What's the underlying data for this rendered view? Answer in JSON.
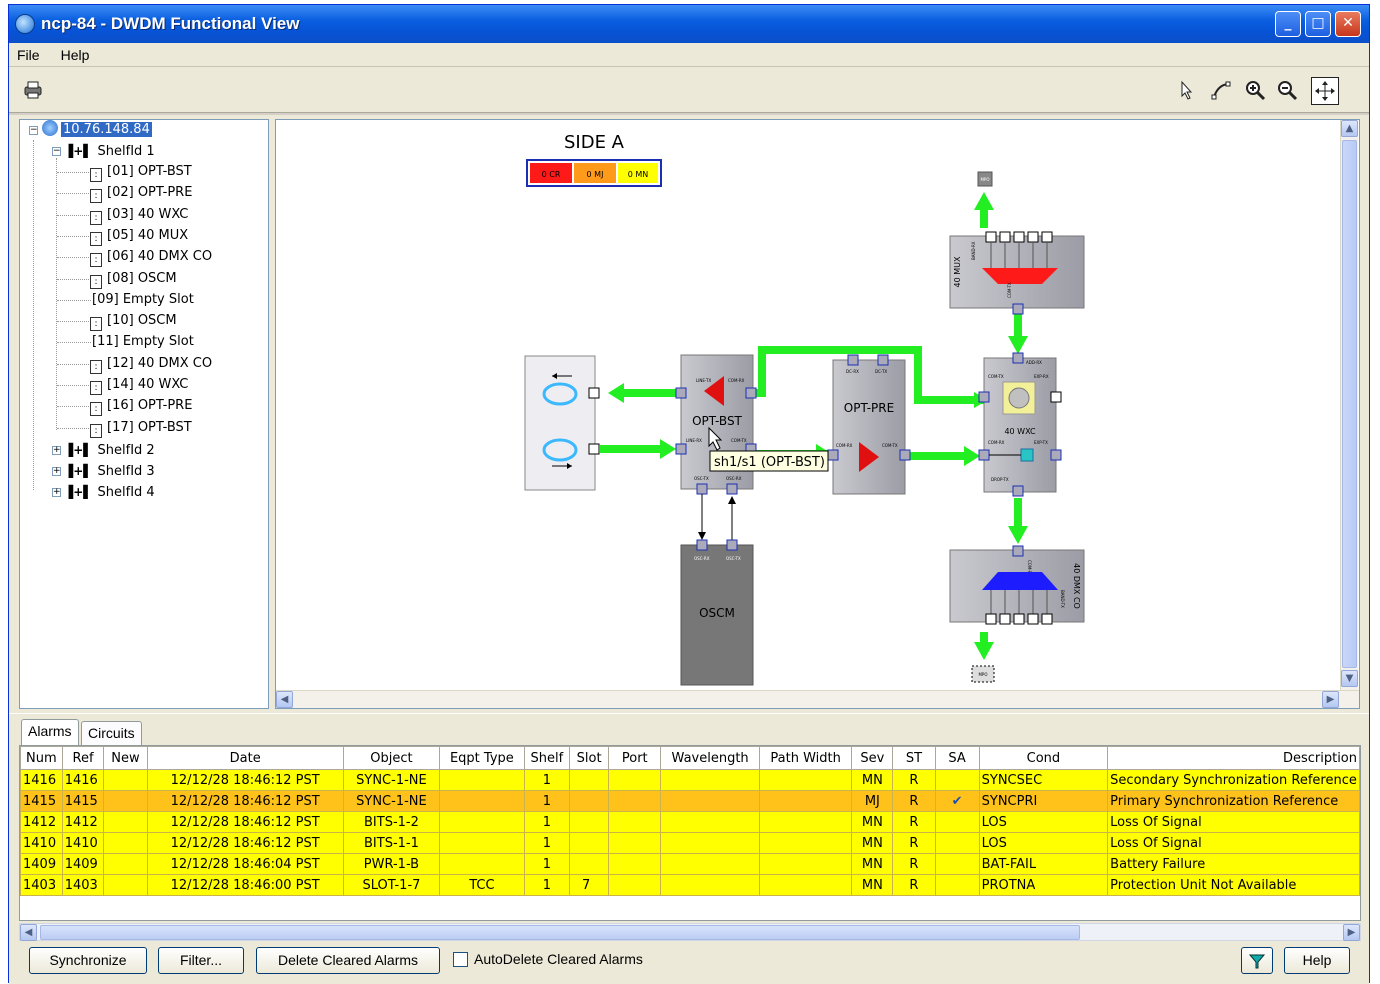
{
  "window": {
    "title": "ncp-84 - DWDM Functional View",
    "minimize": "_",
    "maximize": "□",
    "close": "✕"
  },
  "menu": [
    "File",
    "Help"
  ],
  "toolbar": {
    "print_icon": "printer-icon",
    "zoom_in": "+",
    "zoom_out": "−"
  },
  "tree": {
    "root": "10.76.148.84",
    "shelf1": "ShelfId 1",
    "cards": [
      "[01] OPT-BST",
      "[02] OPT-PRE",
      "[03] 40 WXC",
      "[05] 40 MUX",
      "[06] 40 DMX CO",
      "[08] OSCM",
      "[09] Empty Slot",
      "[10] OSCM",
      "[11] Empty Slot",
      "[12] 40 DMX CO",
      "[14] 40 WXC",
      "[16] OPT-PRE",
      "[17] OPT-BST"
    ],
    "other_shelves": [
      "ShelfId 2",
      "ShelfId 3",
      "ShelfId 4"
    ]
  },
  "diagram": {
    "side": "SIDE A",
    "legend": {
      "cr": "0 CR",
      "mj": "0 MJ",
      "mn": "0 MN"
    },
    "cards": {
      "opt_bst": "OPT-BST",
      "opt_pre": "OPT-PRE",
      "oscm": "OSCM",
      "wxc": "40 WXC",
      "mux": "40 MUX",
      "dmx": "40 DMX CO",
      "mpo_top": "MPO",
      "mpo_bottom": "MPO"
    },
    "port_labels": {
      "line_tx": "LINE-TX",
      "com_rx": "COM-RX",
      "line_rx": "LINE-RX",
      "com_tx": "COM-TX",
      "osc_tx": "OSC-TX",
      "osc_rx": "OSC-RX",
      "dc_rx": "DC-RX",
      "dc_tx": "DC-TX",
      "add_rx": "ADD-RX",
      "exp_rx": "EXP-RX",
      "exp_tx": "EXP-TX",
      "drop_tx": "DROP-TX",
      "band_rx": "BAND-RX",
      "band_tx": "BAND-TX",
      "com_rx_b": "COM-RX"
    },
    "tooltip": "sh1/s1 (OPT-BST)"
  },
  "alarms": {
    "tabs": [
      "Alarms",
      "Circuits"
    ],
    "columns": [
      "Num",
      "Ref",
      "New",
      "Date",
      "Object",
      "Eqpt Type",
      "Shelf",
      "Slot",
      "Port",
      "Wavelength",
      "Path Width",
      "Sev",
      "ST",
      "SA",
      "Cond",
      "Description"
    ],
    "rows": [
      {
        "num": "1416",
        "ref": "1416",
        "new": "",
        "date": "12/12/28 18:46:12 PST",
        "object": "SYNC-1-NE",
        "eqpt": "",
        "shelf": "1",
        "slot": "",
        "port": "",
        "wave": "",
        "pw": "",
        "sev": "MN",
        "st": "R",
        "sa": "",
        "cond": "SYNCSEC",
        "desc": "Secondary Synchronization Reference"
      },
      {
        "num": "1415",
        "ref": "1415",
        "new": "",
        "date": "12/12/28 18:46:12 PST",
        "object": "SYNC-1-NE",
        "eqpt": "",
        "shelf": "1",
        "slot": "",
        "port": "",
        "wave": "",
        "pw": "",
        "sev": "MJ",
        "st": "R",
        "sa": "✔",
        "cond": "SYNCPRI",
        "desc": "Primary Synchronization Reference"
      },
      {
        "num": "1412",
        "ref": "1412",
        "new": "",
        "date": "12/12/28 18:46:12 PST",
        "object": "BITS-1-2",
        "eqpt": "",
        "shelf": "1",
        "slot": "",
        "port": "",
        "wave": "",
        "pw": "",
        "sev": "MN",
        "st": "R",
        "sa": "",
        "cond": "LOS",
        "desc": "Loss Of Signal"
      },
      {
        "num": "1410",
        "ref": "1410",
        "new": "",
        "date": "12/12/28 18:46:12 PST",
        "object": "BITS-1-1",
        "eqpt": "",
        "shelf": "1",
        "slot": "",
        "port": "",
        "wave": "",
        "pw": "",
        "sev": "MN",
        "st": "R",
        "sa": "",
        "cond": "LOS",
        "desc": "Loss Of Signal"
      },
      {
        "num": "1409",
        "ref": "1409",
        "new": "",
        "date": "12/12/28 18:46:04 PST",
        "object": "PWR-1-B",
        "eqpt": "",
        "shelf": "1",
        "slot": "",
        "port": "",
        "wave": "",
        "pw": "",
        "sev": "MN",
        "st": "R",
        "sa": "",
        "cond": "BAT-FAIL",
        "desc": "Battery Failure"
      },
      {
        "num": "1403",
        "ref": "1403",
        "new": "",
        "date": "12/12/28 18:46:00 PST",
        "object": "SLOT-1-7",
        "eqpt": "TCC",
        "shelf": "1",
        "slot": "7",
        "port": "",
        "wave": "",
        "pw": "",
        "sev": "MN",
        "st": "R",
        "sa": "",
        "cond": "PROTNA",
        "desc": "Protection Unit Not Available"
      }
    ]
  },
  "buttons": {
    "synchronize": "Synchronize",
    "filter": "Filter...",
    "delete_cleared": "Delete Cleared Alarms",
    "autodelete": "AutoDelete Cleared Alarms",
    "help": "Help"
  },
  "colors": {
    "fiber": "#22ee22",
    "critical": "#ff1a1a",
    "major": "#ff9a1a",
    "minor": "#ffff00",
    "selection": "#316ac5"
  }
}
